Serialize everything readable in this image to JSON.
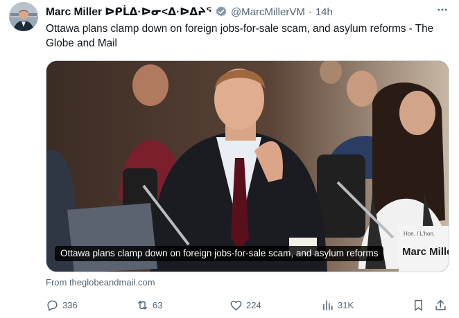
{
  "tweet": {
    "author_name": "Marc Miller ᐅᑭᒫᐃᐅᓂᐊᕐᐃᓐᐊᔅᐟ",
    "author_name_display": "Marc Miller ᐅᑭᒫᐃ·ᐅᓂ<ᐃ·ᐅᐃᔨᕐ",
    "handle": "@MarcMillerVM",
    "separator": "·",
    "time": "14h",
    "text": "Ottawa plans clamp down on foreign jobs-for-sale scam, and asylum reforms - The Globe and Mail",
    "media_caption": "Ottawa plans clamp down on foreign jobs-for-sale scam, and asylum reforms",
    "nameplate_text": "Marc Mille",
    "nameplate_small": "Hon. / L'hon.",
    "source": "From theglobeandmail.com"
  },
  "actions": {
    "replies": "336",
    "reposts": "63",
    "likes": "224",
    "views": "31K"
  },
  "colors": {
    "verified": "#829aab",
    "muted": "#536471",
    "text": "#0f1419"
  },
  "icons": [
    "verified-badge-icon",
    "more-icon",
    "reply-icon",
    "repost-icon",
    "like-icon",
    "views-icon",
    "bookmark-icon",
    "share-icon"
  ]
}
